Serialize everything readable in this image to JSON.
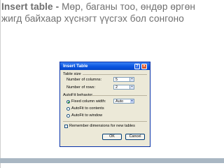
{
  "slide": {
    "heading_bold": "Insert table -",
    "heading_rest": " Мөр, баганы тоо, өндөр өргөн жигд байхаар хүснэгт үүсгэх бол сонгоно"
  },
  "dialog": {
    "title": "Insert Table",
    "help_label": "?",
    "close_label": "×",
    "table_size": {
      "label": "Table size",
      "columns_label": "Number of columns:",
      "columns_value": "5",
      "rows_label": "Number of rows:",
      "rows_value": "2"
    },
    "autofit": {
      "label": "AutoFit behavior",
      "fixed_label": "Fixed column width:",
      "fixed_value": "Auto",
      "contents_label": "AutoFit to contents",
      "window_label": "AutoFit to window"
    },
    "remember_label": "Remember dimensions for new tables",
    "ok_label": "OK",
    "cancel_label": "Cancel"
  }
}
